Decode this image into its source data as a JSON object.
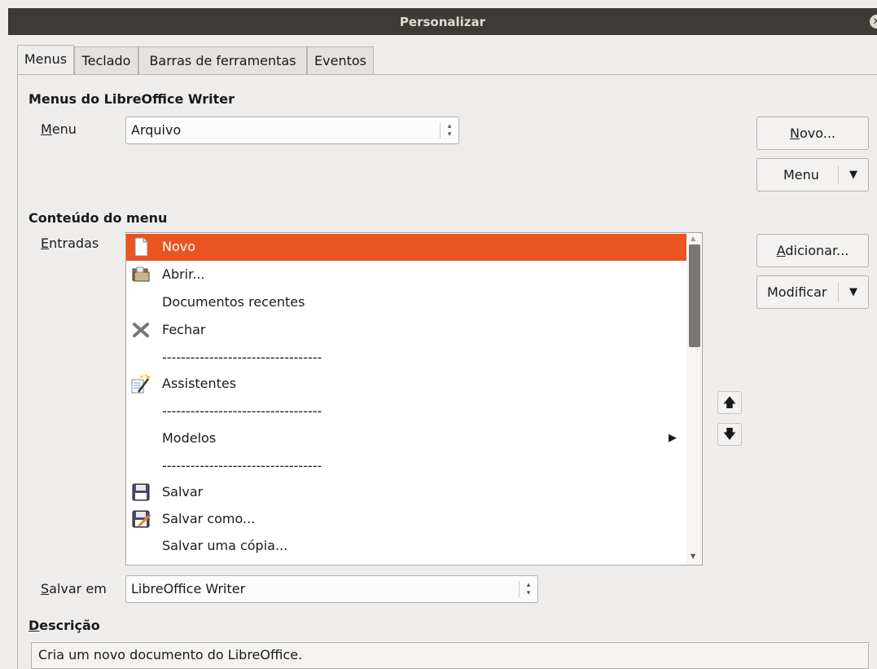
{
  "window": {
    "title": "Personalizar"
  },
  "tabs": [
    {
      "label": "Menus"
    },
    {
      "label": "Teclado"
    },
    {
      "label": "Barras de ferramentas"
    },
    {
      "label": "Eventos"
    }
  ],
  "menus_section": {
    "heading": "Menus do LibreOffice Writer",
    "menu_label_prefix": "M",
    "menu_label_rest": "enu",
    "menu_value": "Arquivo"
  },
  "right_buttons": {
    "novo_prefix": "N",
    "novo_rest": "ovo...",
    "menu": "Menu",
    "adicionar_prefix": "A",
    "adicionar_rest": "dicionar...",
    "modificar": "Modificar"
  },
  "content_section": {
    "heading": "Conteúdo do menu",
    "entries_label_prefix": "E",
    "entries_label_rest": "ntradas"
  },
  "entries": [
    {
      "label": "Novo",
      "icon": "new-document-icon"
    },
    {
      "label": "Abrir...",
      "icon": "open-folder-icon"
    },
    {
      "label": "Documentos recentes",
      "icon": ""
    },
    {
      "label": "Fechar",
      "icon": "close-x-icon"
    },
    {
      "label": "----------------------------------",
      "icon": ""
    },
    {
      "label": "Assistentes",
      "icon": "wizard-icon"
    },
    {
      "label": "----------------------------------",
      "icon": ""
    },
    {
      "label": "Modelos",
      "icon": "",
      "submenu": true
    },
    {
      "label": "----------------------------------",
      "icon": ""
    },
    {
      "label": "Salvar",
      "icon": "save-icon"
    },
    {
      "label": "Salvar como...",
      "icon": "save-as-icon"
    },
    {
      "label": "Salvar uma cópia...",
      "icon": ""
    }
  ],
  "save_in": {
    "label_prefix": "S",
    "label_rest": "alvar em",
    "value": "LibreOffice Writer"
  },
  "description": {
    "label_prefix": "D",
    "label_rest": "escrição",
    "text": "Cria um novo documento do LibreOffice."
  },
  "colors": {
    "selection": "#e95420",
    "titlebar": "#3c3b37",
    "background": "#efedec"
  }
}
